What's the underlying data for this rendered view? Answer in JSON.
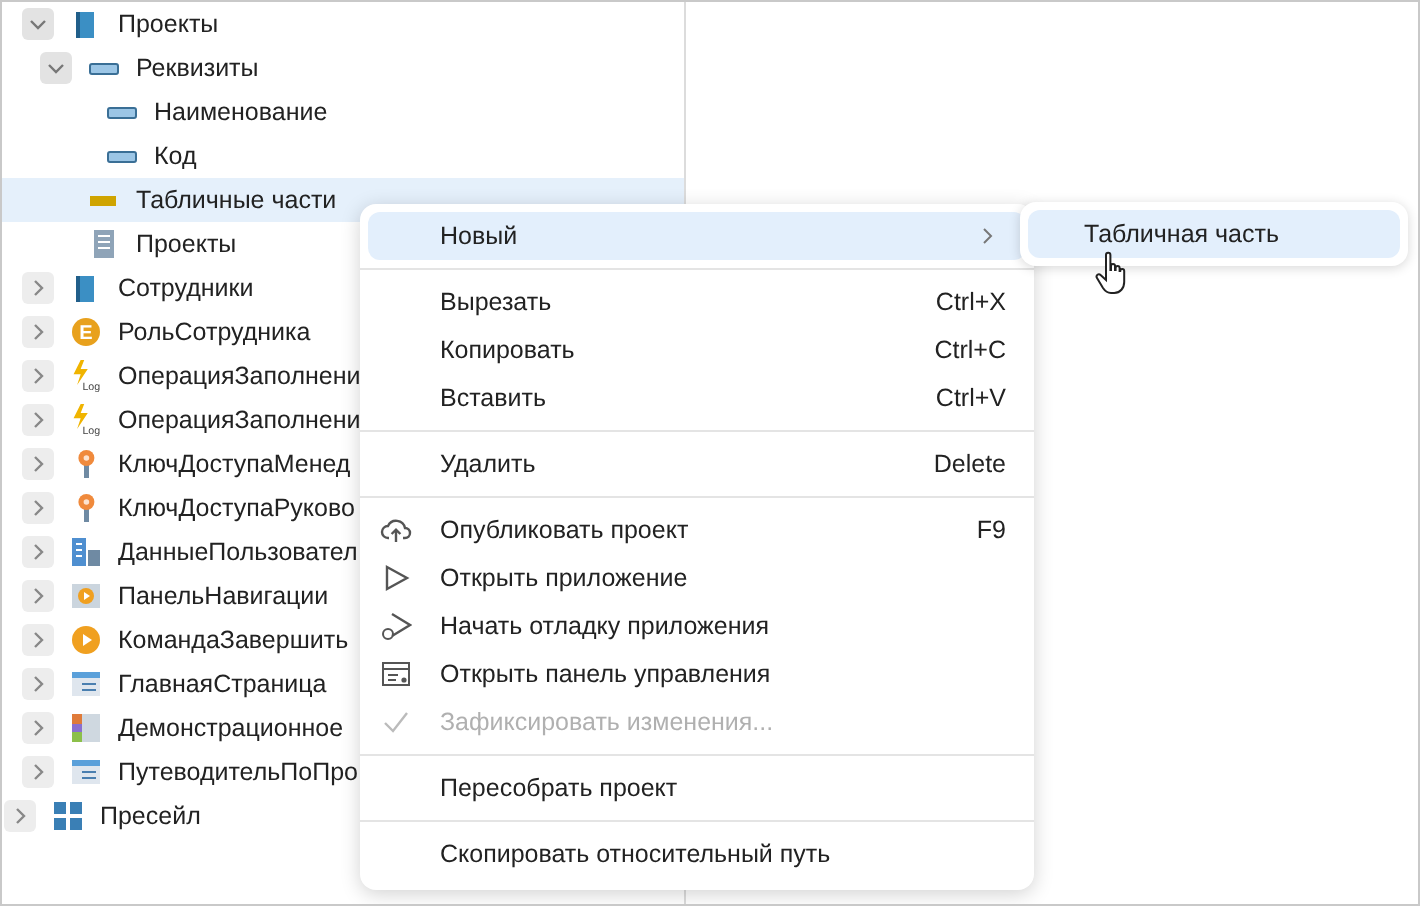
{
  "tree": [
    {
      "children": [
        {
          "label": "Проекты",
          "kind": "book",
          "expanded": true,
          "selected": false,
          "children": [
            {
              "label": "Реквизиты",
              "kind": "field",
              "expanded": true,
              "selected": false,
              "children": [
                {
                  "label": "Наименование",
                  "kind": "field",
                  "selected": false
                },
                {
                  "label": "Код",
                  "kind": "field",
                  "selected": false
                }
              ]
            },
            {
              "label": "Табличные части",
              "kind": "table-part",
              "selected": true
            },
            {
              "label": "Проекты",
              "kind": "document",
              "selected": false
            }
          ]
        },
        {
          "label": "Сотрудники",
          "kind": "book",
          "expanded": false,
          "selected": false
        },
        {
          "label": "РольСотрудника",
          "kind": "role",
          "icon_text": "E",
          "expanded": false,
          "selected": false
        },
        {
          "label": "ОперацияЗаполнени",
          "kind": "log",
          "icon_text": "Log",
          "expanded": false,
          "selected": false
        },
        {
          "label": "ОперацияЗаполнени",
          "kind": "log",
          "icon_text": "Log",
          "expanded": false,
          "selected": false
        },
        {
          "label": "КлючДоступаМенед",
          "kind": "key",
          "expanded": false,
          "selected": false
        },
        {
          "label": "КлючДоступаРуково",
          "kind": "key",
          "expanded": false,
          "selected": false
        },
        {
          "label": "ДанныеПользовател",
          "kind": "data",
          "expanded": false,
          "selected": false
        },
        {
          "label": "ПанельНавигации",
          "kind": "panel",
          "expanded": false,
          "selected": false
        },
        {
          "label": "КомандаЗавершить",
          "kind": "command",
          "expanded": false,
          "selected": false
        },
        {
          "label": "ГлавнаяСтраница",
          "kind": "page",
          "expanded": false,
          "selected": false
        },
        {
          "label": "Демонстрационное",
          "kind": "demo",
          "expanded": false,
          "selected": false
        },
        {
          "label": "ПутеводительПоПро",
          "kind": "page",
          "expanded": false,
          "selected": false
        }
      ]
    },
    {
      "label": "Пресейл",
      "kind": "grid",
      "expanded": false,
      "selected": false
    }
  ],
  "context_menu": [
    {
      "kind": "item",
      "label": "Новый",
      "submenu": true,
      "selected": true,
      "disabled": false
    },
    {
      "kind": "separator"
    },
    {
      "kind": "item",
      "label": "Вырезать",
      "shortcut": "Ctrl+X",
      "selected": false,
      "disabled": false
    },
    {
      "kind": "item",
      "label": "Копировать",
      "shortcut": "Ctrl+C",
      "selected": false,
      "disabled": false
    },
    {
      "kind": "item",
      "label": "Вставить",
      "shortcut": "Ctrl+V",
      "selected": false,
      "disabled": false
    },
    {
      "kind": "separator"
    },
    {
      "kind": "item",
      "label": "Удалить",
      "shortcut": "Delete",
      "selected": false,
      "disabled": false
    },
    {
      "kind": "separator"
    },
    {
      "kind": "publish",
      "label": "Опубликовать проект",
      "shortcut": "F9",
      "selected": false,
      "disabled": false
    },
    {
      "kind": "open",
      "label": "Открыть приложение",
      "selected": false,
      "disabled": false
    },
    {
      "kind": "debug",
      "label": "Начать отладку приложения",
      "selected": false,
      "disabled": false
    },
    {
      "kind": "dashboard",
      "label": "Открыть панель управления",
      "selected": false,
      "disabled": false
    },
    {
      "kind": "commit",
      "label": "Зафиксировать изменения...",
      "selected": false,
      "disabled": true
    },
    {
      "kind": "separator"
    },
    {
      "kind": "item",
      "label": "Пересобрать проект",
      "selected": false,
      "disabled": false
    },
    {
      "kind": "separator"
    },
    {
      "kind": "item",
      "label": "Скопировать относительный путь",
      "selected": false,
      "disabled": false
    }
  ],
  "submenu": [
    {
      "label": "Табличная часть",
      "selected": true
    }
  ]
}
